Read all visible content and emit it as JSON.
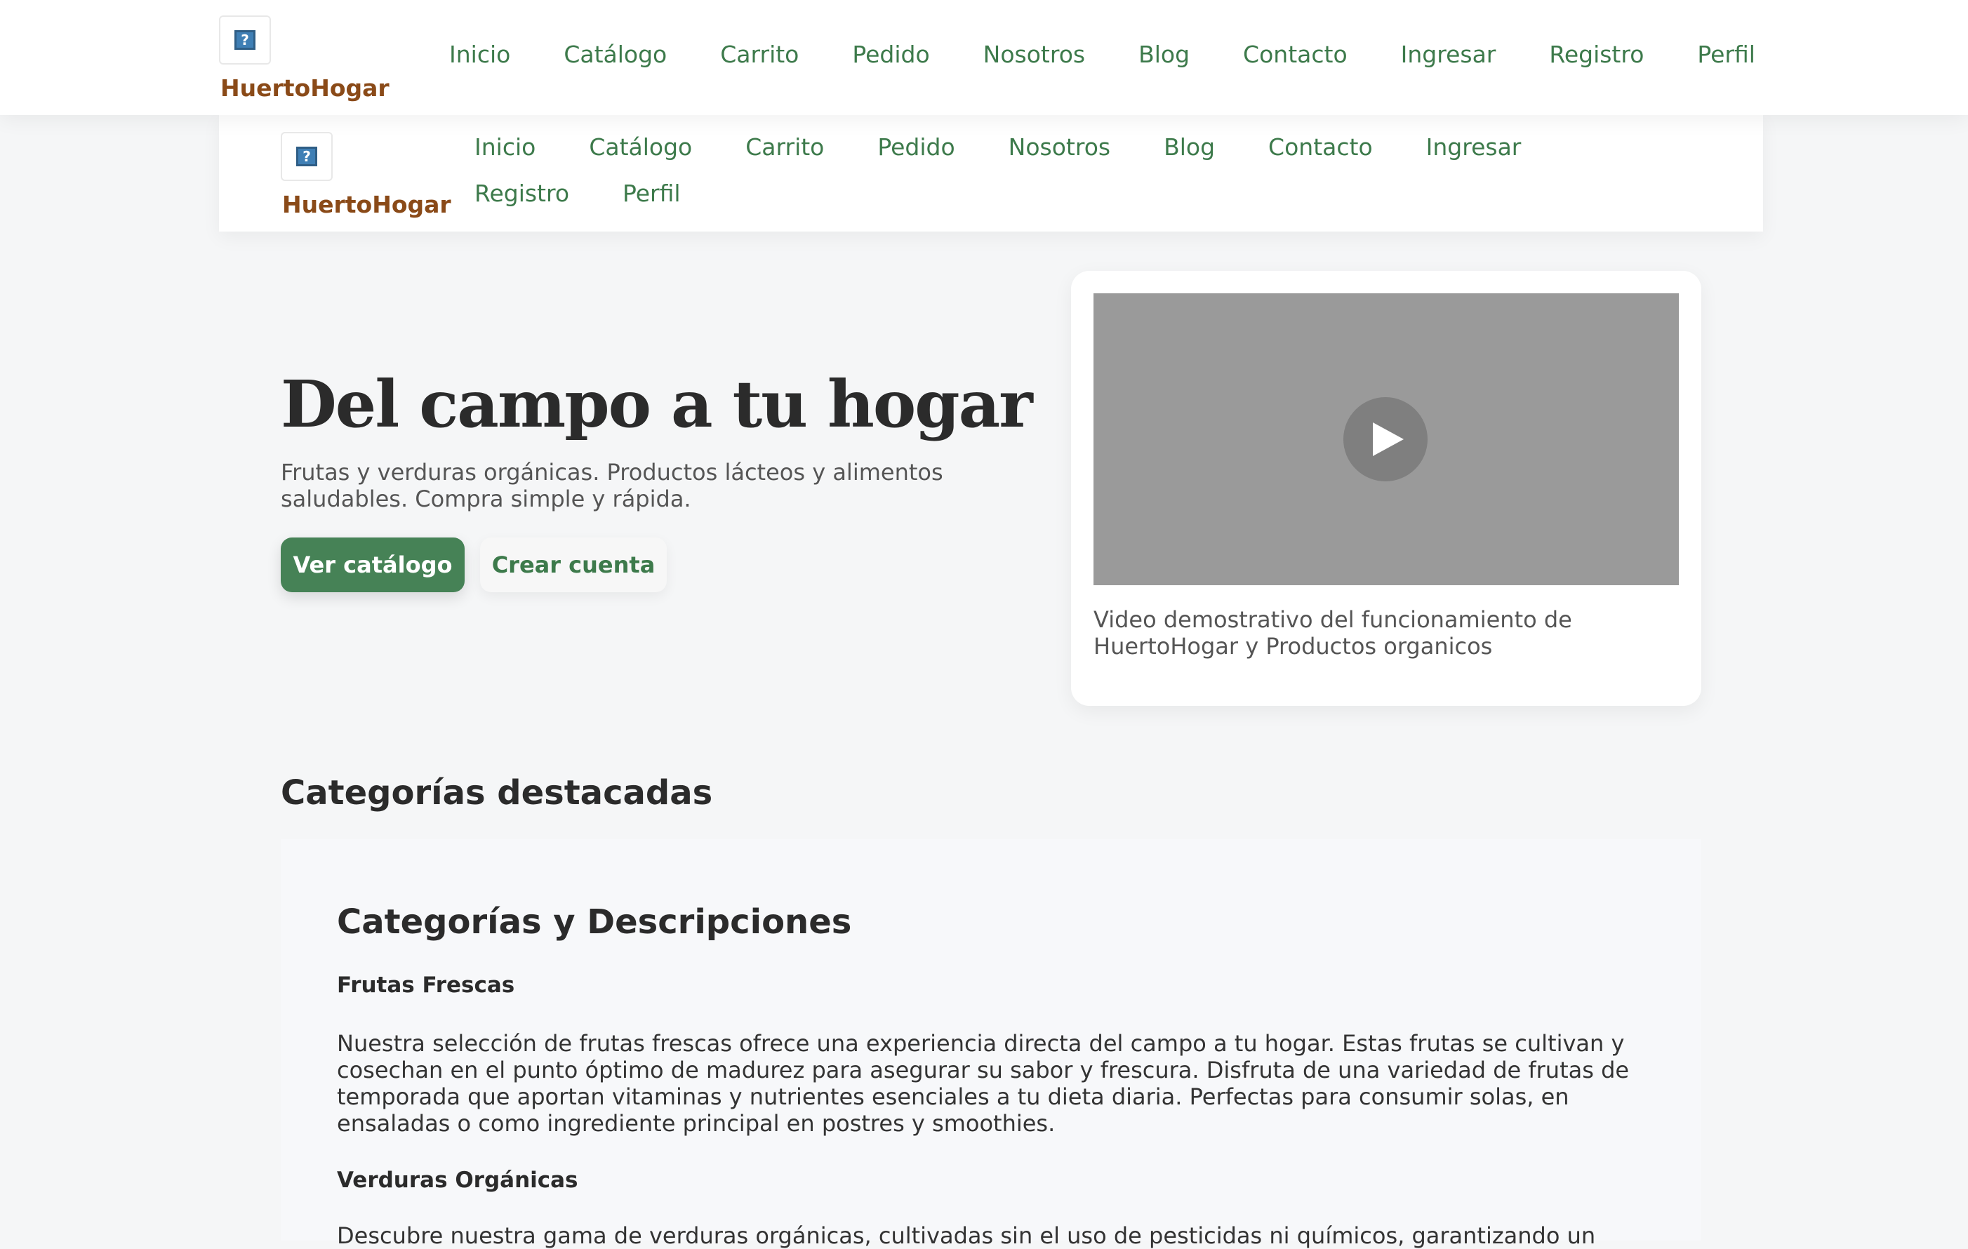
{
  "brand": {
    "name": "HuertoHogar",
    "logo_icon": "broken-image-icon",
    "logo_glyph": "?"
  },
  "nav": {
    "items": [
      "Inicio",
      "Catálogo",
      "Carrito",
      "Pedido",
      "Nosotros",
      "Blog",
      "Contacto",
      "Ingresar",
      "Registro",
      "Perfil"
    ]
  },
  "hero": {
    "title": "Del campo a tu hogar",
    "subtitle": "Frutas y verduras orgánicas. Productos lácteos y alimentos saludables. Compra simple y rápida.",
    "primary_button": "Ver catálogo",
    "secondary_button": "Crear cuenta"
  },
  "video": {
    "play_icon": "play-icon",
    "caption": "Video demostrativo del funcionamiento de HuertoHogar y Productos organicos"
  },
  "categories": {
    "section_title": "Categorías destacadas",
    "panel_title": "Categorías y Descripciones",
    "items": [
      {
        "name": "Frutas Frescas",
        "description": "Nuestra selección de frutas frescas ofrece una experiencia directa del campo a tu hogar. Estas frutas se cultivan y cosechan en el punto óptimo de madurez para asegurar su sabor y frescura. Disfruta de una variedad de frutas de temporada que aportan vitaminas y nutrientes esenciales a tu dieta diaria. Perfectas para consumir solas, en ensaladas o como ingrediente principal en postres y smoothies."
      },
      {
        "name": "Verduras Orgánicas",
        "description": "Descubre nuestra gama de verduras orgánicas, cultivadas sin el uso de pesticidas ni químicos, garantizando un"
      }
    ]
  },
  "colors": {
    "brand": "#8a4a18",
    "nav_link": "#3d7a4b",
    "primary_button": "#468256",
    "video_placeholder": "#9a9a9a"
  }
}
